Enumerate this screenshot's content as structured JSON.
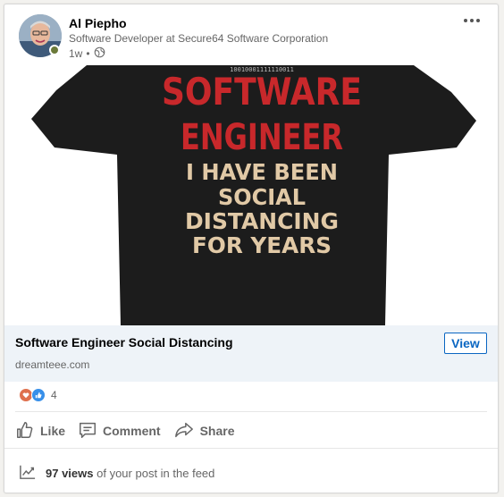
{
  "post": {
    "author_name": "Al Piepho",
    "author_headline": "Software Developer at Secure64 Software Corporation",
    "time": "1w",
    "separator": "•",
    "visibility_icon": "globe-icon"
  },
  "image": {
    "small_text": "10010001111110011",
    "line1": "SOFTWARE",
    "line2": "ENGINEER",
    "line3": "I HAVE BEEN",
    "line4": "SOCIAL",
    "line5": "DISTANCING",
    "line6": "FOR YEARS",
    "colors": {
      "shirt": "#1c1c1c",
      "red_text": "#c8282b",
      "tan_text": "#e1c9a6"
    }
  },
  "link": {
    "title": "Software Engineer Social Distancing",
    "domain": "dreamteee.com",
    "button": "View"
  },
  "reactions": {
    "count": "4",
    "types": [
      "love-icon",
      "like-icon"
    ]
  },
  "actions": [
    {
      "label": "Like",
      "icon": "thumbs-up-icon"
    },
    {
      "label": "Comment",
      "icon": "comment-icon"
    },
    {
      "label": "Share",
      "icon": "share-icon"
    }
  ],
  "footer": {
    "views": "97 views",
    "suffix": "of your post in the feed"
  },
  "colors": {
    "accent": "#0a66c2",
    "link_bar": "#eef3f8"
  }
}
